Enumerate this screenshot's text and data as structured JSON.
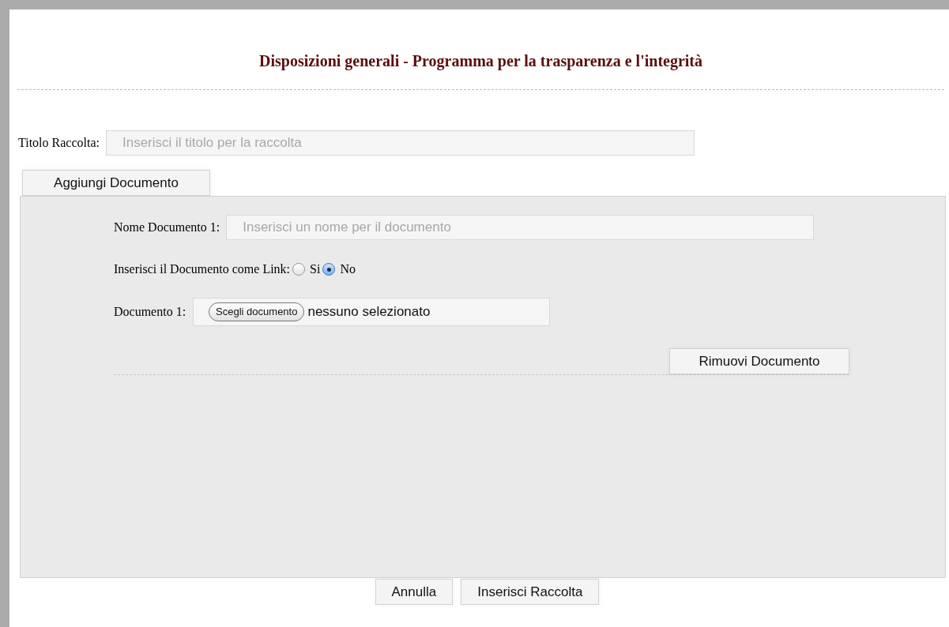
{
  "title": "Disposizioni generali - Programma per la trasparenza e l'integrità",
  "collection_title": {
    "label": "Titolo Raccolta:",
    "placeholder": "Inserisci il titolo per la raccolta"
  },
  "add_button": "Aggiungi Documento",
  "documents": [
    {
      "name_field": {
        "label": "Nome Documento 1:",
        "placeholder": "Inserisci un nome per il documento"
      },
      "link_option": {
        "label": "Inserisci il Documento come Link:",
        "options": [
          {
            "label": "Si",
            "selected": false
          },
          {
            "label": "No",
            "selected": true
          }
        ]
      },
      "file_field": {
        "label": "Documento 1:",
        "button": "Scegli documento",
        "status": "nessuno selezionato"
      },
      "remove_button": "Rimuovi Documento"
    }
  ],
  "footer_buttons": [
    "Annulla",
    "Inserisci Raccolta"
  ]
}
